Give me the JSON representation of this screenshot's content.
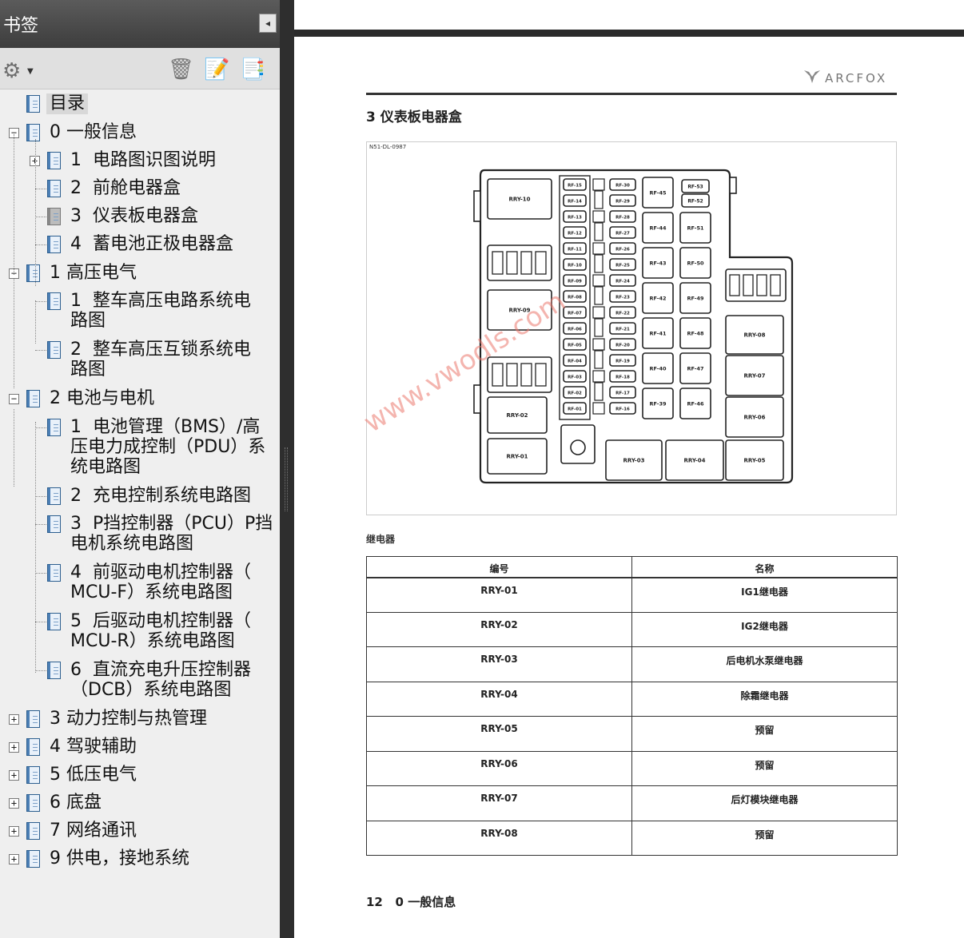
{
  "bookmarks_panel": {
    "title": "书签",
    "collapse_icon": "◂",
    "toolbar": {
      "options_icon": "gear-icon",
      "delete_icon": "trash-icon",
      "new_bookmark_icon": "new-bookmark-icon",
      "bookmark_properties_icon": "bookmark-properties-icon"
    },
    "items": [
      {
        "label": "目录",
        "level": 0,
        "toggle": "",
        "selected": true
      },
      {
        "label": "0 一般信息",
        "level": 0,
        "toggle": "−"
      },
      {
        "label": "1  电路图识图说明",
        "level": 1,
        "toggle": "+"
      },
      {
        "label": "2  前舱电器盒",
        "level": 1,
        "toggle": ""
      },
      {
        "label": "3  仪表板电器盒",
        "level": 1,
        "toggle": "",
        "current": true
      },
      {
        "label": "4  蓄电池正极电器盒",
        "level": 1,
        "toggle": ""
      },
      {
        "label": "1 高压电气",
        "level": 0,
        "toggle": "−"
      },
      {
        "label": "1  整车高压电路系统电\n路图",
        "level": 1,
        "toggle": ""
      },
      {
        "label": "2  整车高压互锁系统电\n路图",
        "level": 1,
        "toggle": ""
      },
      {
        "label": "2 电池与电机",
        "level": 0,
        "toggle": "−"
      },
      {
        "label": "1  电池管理（BMS）/高\n压电力成控制（PDU）系\n统电路图",
        "level": 1,
        "toggle": ""
      },
      {
        "label": "2  充电控制系统电路图",
        "level": 1,
        "toggle": ""
      },
      {
        "label": "3  P挡控制器（PCU）P挡\n电机系统电路图",
        "level": 1,
        "toggle": ""
      },
      {
        "label": "4  前驱动电机控制器（\nMCU-F）系统电路图",
        "level": 1,
        "toggle": ""
      },
      {
        "label": "5  后驱动电机控制器（\nMCU-R）系统电路图",
        "level": 1,
        "toggle": ""
      },
      {
        "label": "6  直流充电升压控制器\n（DCB）系统电路图",
        "level": 1,
        "toggle": ""
      },
      {
        "label": "3 动力控制与热管理",
        "level": 0,
        "toggle": "+"
      },
      {
        "label": "4 驾驶辅助",
        "level": 0,
        "toggle": "+"
      },
      {
        "label": "5 低压电气",
        "level": 0,
        "toggle": "+"
      },
      {
        "label": "6 底盘",
        "level": 0,
        "toggle": "+"
      },
      {
        "label": "7 网络通讯",
        "level": 0,
        "toggle": "+"
      },
      {
        "label": "9 供电，接地系统",
        "level": 0,
        "toggle": "+"
      }
    ]
  },
  "document": {
    "brand_logo_text": "ARCFOX",
    "section_title": "3 仪表板电器盒",
    "figure_code": "N51-DL-0987",
    "watermark": "www.vwodls.com",
    "fuse_box": {
      "relays": [
        "RRY-10",
        "RRY-09",
        "RRY-02",
        "RRY-01",
        "RRY-03",
        "RRY-04",
        "RRY-05",
        "RRY-06",
        "RRY-07",
        "RRY-08"
      ],
      "fuses_col1": [
        "RF-15",
        "RF-14",
        "RF-13",
        "RF-12",
        "RF-11",
        "RF-10",
        "RF-09",
        "RF-08",
        "RF-07",
        "RF-06",
        "RF-05",
        "RF-04",
        "RF-03",
        "RF-02",
        "RF-01"
      ],
      "fuses_col2": [
        "RF-30",
        "RF-29",
        "RF-28",
        "RF-27",
        "RF-26",
        "RF-25",
        "RF-24",
        "RF-23",
        "RF-22",
        "RF-21",
        "RF-20",
        "RF-19",
        "RF-18",
        "RF-17",
        "RF-16"
      ],
      "fuses_col3": [
        "RF-45",
        "RF-44",
        "RF-43",
        "RF-42",
        "RF-41",
        "RF-40",
        "RF-39"
      ],
      "fuses_col4": [
        "RF-53",
        "RF-52",
        "RF-51",
        "RF-50",
        "RF-49",
        "RF-48",
        "RF-47",
        "RF-46"
      ]
    },
    "relay_caption": "继电器",
    "relay_table": {
      "headers": [
        "编号",
        "名称"
      ],
      "rows": [
        [
          "RRY-01",
          "IG1继电器"
        ],
        [
          "RRY-02",
          "IG2继电器"
        ],
        [
          "RRY-03",
          "后电机水泵继电器"
        ],
        [
          "RRY-04",
          "除霜继电器"
        ],
        [
          "RRY-05",
          "预留"
        ],
        [
          "RRY-06",
          "预留"
        ],
        [
          "RRY-07",
          "后灯模块继电器"
        ],
        [
          "RRY-08",
          "预留"
        ]
      ]
    },
    "footer": "12   0 一般信息"
  }
}
